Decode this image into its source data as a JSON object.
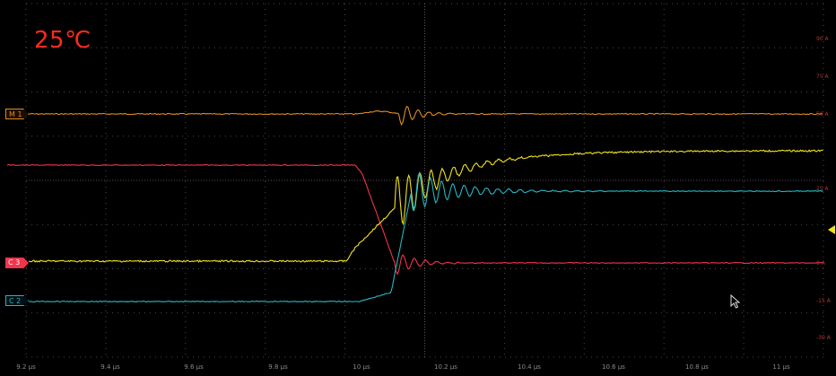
{
  "screen": {
    "temperature_label": "25℃"
  },
  "channels": [
    {
      "id": "m1",
      "label": "M 1",
      "color": "#e08a22"
    },
    {
      "id": "c3",
      "label": "C 3",
      "color": "#f0354a"
    },
    {
      "id": "c2",
      "label": "C 2",
      "color": "#27b6c2"
    }
  ],
  "x_axis": {
    "tick_labels": [
      "9.2 µs",
      "9.4 µs",
      "9.6 µs",
      "9.8 µs",
      "10 µs",
      "10.2 µs",
      "10.4 µs",
      "10.6 µs",
      "10.8 µs",
      "11 µs"
    ]
  },
  "y_axis_right": {
    "tick_labels": [
      "90 A",
      "75 A",
      "50 A",
      "25 A",
      "0 A",
      "-15 A",
      "-30 A"
    ]
  },
  "colors": {
    "math_trace": "#e08a22",
    "ch3_trace": "#f0354a",
    "yellow_trace": "#f2e21c",
    "ch2_trace": "#27b6c2",
    "grid": "#4a4a4a",
    "temperature_text": "#ff2a1f"
  },
  "icons": {
    "trigger_marker": "trigger-level-icon",
    "mouse_pointer": "mouse-pointer-icon"
  }
}
